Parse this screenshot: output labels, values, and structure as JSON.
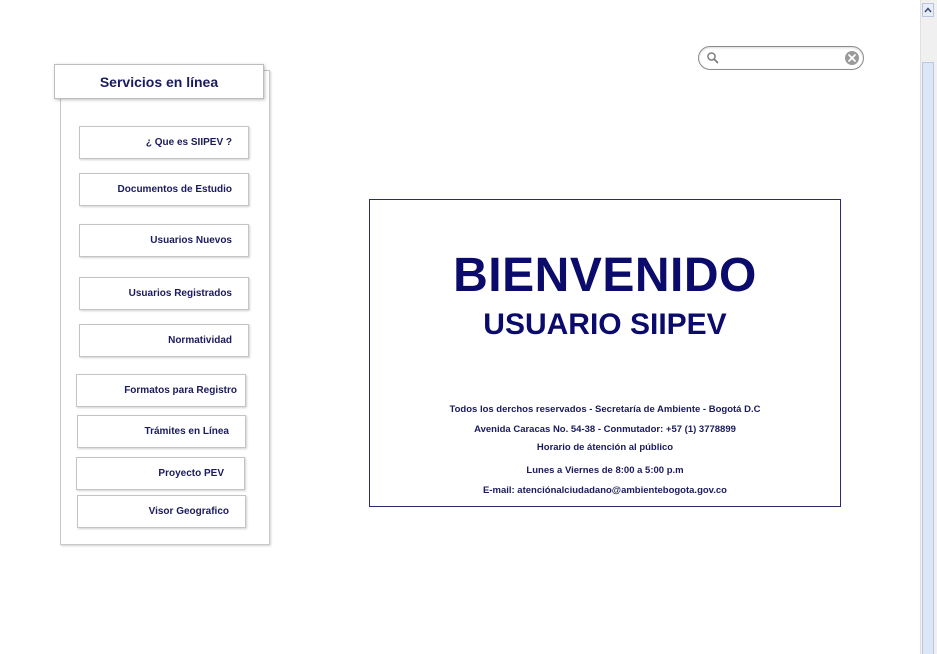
{
  "search": {
    "placeholder": "",
    "value": ""
  },
  "sidebar": {
    "title": "Servicios en línea",
    "items": [
      {
        "label": "¿ Que es SIIPEV ?"
      },
      {
        "label": "Documentos de Estudio"
      },
      {
        "label": "Usuarios Nuevos"
      },
      {
        "label": "Usuarios Registrados"
      },
      {
        "label": "Normatividad"
      },
      {
        "label": "Formatos para Registro"
      },
      {
        "label": "Trámites en Línea"
      },
      {
        "label": "Proyecto PEV"
      },
      {
        "label": "Visor Geografico"
      }
    ]
  },
  "welcome": {
    "title": "BIENVENIDO",
    "subtitle": "USUARIO SIIPEV",
    "info": [
      "Todos los derchos reservados - Secretaría de Ambiente - Bogotá D.C",
      "Avenida Caracas No. 54-38 - Conmutador: +57 (1) 3778899",
      "Horario de átención al público",
      "Lunes a Viernes de 8:00 a 5:00 p.m",
      "E-mail: atenciónalciudadano@ambientebogota.gov.co"
    ]
  },
  "colors": {
    "accent": "#0b0b6b",
    "text": "#1a1a5e",
    "border": "#c4c4c4",
    "scrollbar_thumb": "#dbe6f7"
  },
  "icons": {
    "search": "magnifier-icon",
    "clear": "clear-circle-x-icon",
    "scroll_up": "chevron-up-icon"
  }
}
